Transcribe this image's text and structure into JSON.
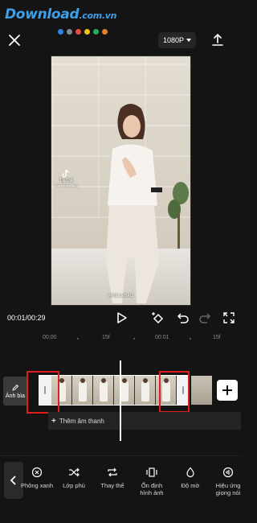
{
  "watermark": {
    "text": "Download",
    "suffix": ".com.vn",
    "dot_colors": [
      "#2e86de",
      "#7f8c8d",
      "#e74c3c",
      "#f1c40f",
      "#27ae60",
      "#e67e22"
    ]
  },
  "header": {
    "resolution": "1080P"
  },
  "preview": {
    "watermark_brand": "TikTok",
    "watermark_user": "@kimlebaovang",
    "caption": "AKIMLEBAO"
  },
  "playback": {
    "time": "00:01/00:29"
  },
  "ruler": {
    "labels": [
      "00:00",
      "15f",
      "00:01",
      "15f"
    ]
  },
  "timeline": {
    "cover_label": "Ảnh bìa",
    "add_audio_label": "Thêm âm thanh"
  },
  "toolbar": {
    "items": [
      {
        "label": "Phông xanh",
        "icon": "x-circle-icon"
      },
      {
        "label": "Lớp phủ",
        "icon": "shuffle-icon"
      },
      {
        "label": "Thay thế",
        "icon": "replace-icon"
      },
      {
        "label": "Ổn định\nhình ảnh",
        "icon": "stabilize-icon"
      },
      {
        "label": "Độ mờ",
        "icon": "opacity-icon"
      },
      {
        "label": "Hiệu ứng\ngiọng nói",
        "icon": "voice-effect-icon"
      }
    ]
  },
  "colors": {
    "background": "#141414",
    "highlight": "#e11d1d",
    "watermark_blue": "#3ea0e8"
  }
}
